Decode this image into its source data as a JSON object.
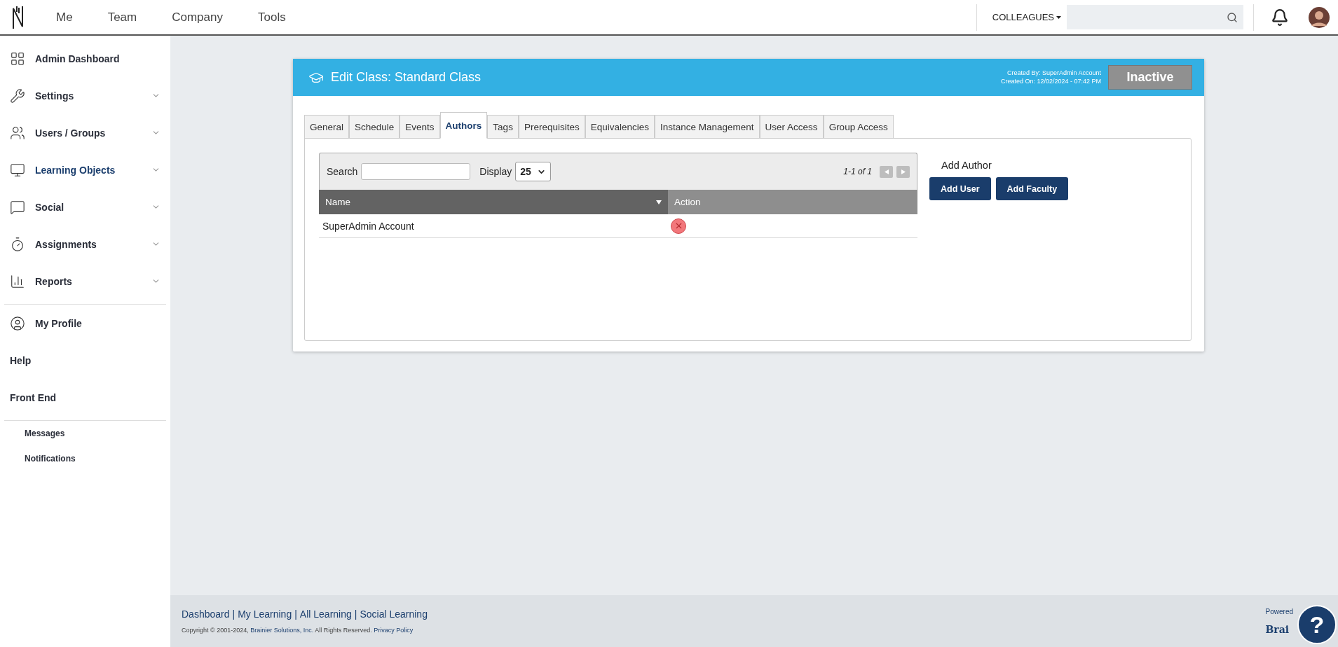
{
  "top_nav": {
    "links": [
      "Me",
      "Team",
      "Company",
      "Tools"
    ],
    "colleagues_menu": "COLLEAGUES"
  },
  "sidebar": {
    "groups": [
      [
        {
          "label": "Admin Dashboard",
          "kind": "link",
          "selected": false
        },
        {
          "label": "Settings",
          "kind": "menu",
          "selected": false
        },
        {
          "label": "Users / Groups",
          "kind": "menu",
          "selected": false
        },
        {
          "label": "Learning Objects",
          "kind": "menu",
          "selected": true
        },
        {
          "label": "Social",
          "kind": "menu",
          "selected": false
        },
        {
          "label": "Assignments",
          "kind": "menu",
          "selected": false
        },
        {
          "label": "Reports",
          "kind": "menu",
          "selected": false
        }
      ],
      [
        {
          "label": "My Profile",
          "kind": "link",
          "selected": false
        },
        {
          "label": "Help",
          "kind": "plain",
          "selected": false
        },
        {
          "label": "Front End",
          "kind": "plain",
          "selected": false
        }
      ],
      [
        {
          "label": "Messages",
          "kind": "sub",
          "selected": false
        },
        {
          "label": "Notifications",
          "kind": "sub",
          "selected": false
        }
      ]
    ]
  },
  "card": {
    "title": "Edit Class: Standard Class",
    "created_by": "Created By: SuperAdmin Account",
    "created_on": "Created On: 12/02/2024 - 07:42 PM",
    "status": "Inactive",
    "tabs": [
      {
        "label": "General",
        "selected": false
      },
      {
        "label": "Schedule",
        "selected": false
      },
      {
        "label": "Events",
        "selected": false
      },
      {
        "label": "Authors",
        "selected": true
      },
      {
        "label": "Tags",
        "selected": false
      },
      {
        "label": "Prerequisites",
        "selected": false
      },
      {
        "label": "Equivalencies",
        "selected": false
      },
      {
        "label": "Instance Management",
        "selected": false
      },
      {
        "label": "User Access",
        "selected": false
      },
      {
        "label": "Group Access",
        "selected": false
      }
    ],
    "table": {
      "search_label": "Search",
      "display_label": "Display",
      "display_value": "25",
      "pager": "1-1 of 1",
      "columns": [
        {
          "label": "Name",
          "sorted": true
        },
        {
          "label": "Action",
          "sorted": false
        }
      ],
      "rows": [
        {
          "name": "SuperAdmin Account"
        }
      ]
    },
    "add_author": {
      "heading": "Add Author",
      "buttons": [
        "Add User",
        "Add Faculty"
      ]
    }
  },
  "footer": {
    "links": [
      "Dashboard",
      "My Learning",
      "All Learning",
      "Social Learning"
    ],
    "separator": "|",
    "copyright": {
      "prefix": "Copyright © 2001-2024,",
      "company": "Brainier Solutions, Inc.",
      "suffix": "All Rights Reserved.",
      "policy": "Privacy Policy"
    },
    "powered": "Powered",
    "brand": "Brai",
    "help": "?"
  }
}
